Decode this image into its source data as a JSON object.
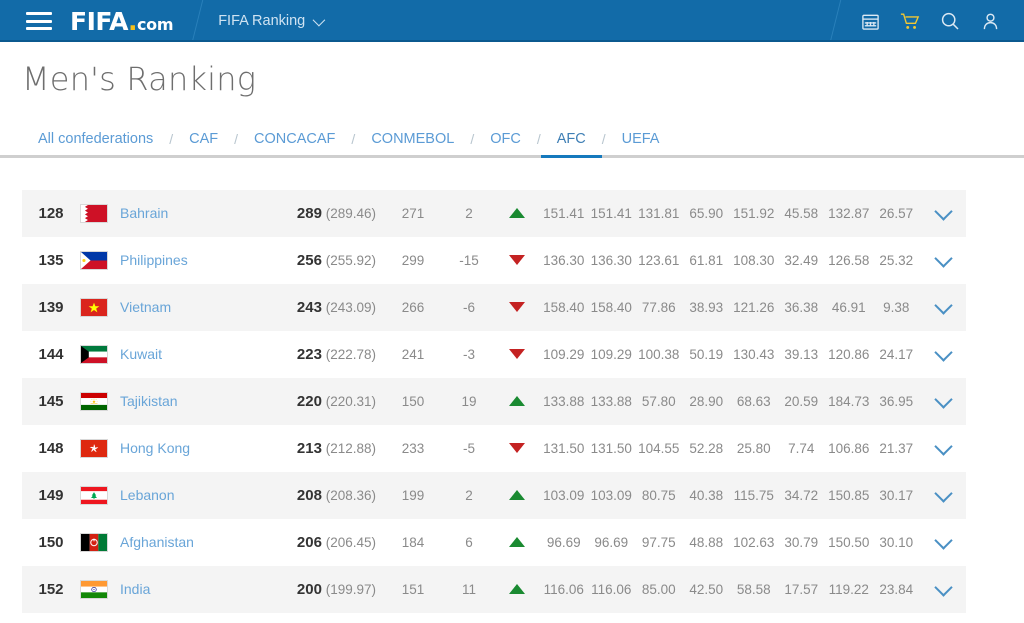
{
  "topbar": {
    "menu_icon": "hamburger-icon",
    "brand": "FIFA",
    "brand_suffix": ".com",
    "section_label": "FIFA Ranking",
    "icons": [
      "calendar-icon",
      "cart-icon",
      "search-icon",
      "user-icon"
    ]
  },
  "header": {
    "title": "Men's Ranking"
  },
  "confederations": {
    "separator": "/",
    "tabs": [
      {
        "label": "All confederations",
        "active": false
      },
      {
        "label": "CAF",
        "active": false
      },
      {
        "label": "CONCACAF",
        "active": false
      },
      {
        "label": "CONMEBOL",
        "active": false
      },
      {
        "label": "OFC",
        "active": false
      },
      {
        "label": "AFC",
        "active": true
      },
      {
        "label": "UEFA",
        "active": false
      }
    ]
  },
  "table": {
    "expand_icon": "chevron-down-icon",
    "rows": [
      {
        "rank": "128",
        "team": "Bahrain",
        "flag": "bahrain",
        "points": "289",
        "points_exact": "(289.46)",
        "previous": "271",
        "delta": "2",
        "trend": "up",
        "values": [
          "151.41",
          "151.41",
          "131.81",
          "65.90",
          "151.92",
          "45.58",
          "132.87",
          "26.57"
        ]
      },
      {
        "rank": "135",
        "team": "Philippines",
        "flag": "philippines",
        "points": "256",
        "points_exact": "(255.92)",
        "previous": "299",
        "delta": "-15",
        "trend": "down",
        "values": [
          "136.30",
          "136.30",
          "123.61",
          "61.81",
          "108.30",
          "32.49",
          "126.58",
          "25.32"
        ]
      },
      {
        "rank": "139",
        "team": "Vietnam",
        "flag": "vietnam",
        "points": "243",
        "points_exact": "(243.09)",
        "previous": "266",
        "delta": "-6",
        "trend": "down",
        "values": [
          "158.40",
          "158.40",
          "77.86",
          "38.93",
          "121.26",
          "36.38",
          "46.91",
          "9.38"
        ]
      },
      {
        "rank": "144",
        "team": "Kuwait",
        "flag": "kuwait",
        "points": "223",
        "points_exact": "(222.78)",
        "previous": "241",
        "delta": "-3",
        "trend": "down",
        "values": [
          "109.29",
          "109.29",
          "100.38",
          "50.19",
          "130.43",
          "39.13",
          "120.86",
          "24.17"
        ]
      },
      {
        "rank": "145",
        "team": "Tajikistan",
        "flag": "tajikistan",
        "points": "220",
        "points_exact": "(220.31)",
        "previous": "150",
        "delta": "19",
        "trend": "up",
        "values": [
          "133.88",
          "133.88",
          "57.80",
          "28.90",
          "68.63",
          "20.59",
          "184.73",
          "36.95"
        ]
      },
      {
        "rank": "148",
        "team": "Hong Kong",
        "flag": "hongkong",
        "points": "213",
        "points_exact": "(212.88)",
        "previous": "233",
        "delta": "-5",
        "trend": "down",
        "values": [
          "131.50",
          "131.50",
          "104.55",
          "52.28",
          "25.80",
          "7.74",
          "106.86",
          "21.37"
        ]
      },
      {
        "rank": "149",
        "team": "Lebanon",
        "flag": "lebanon",
        "points": "208",
        "points_exact": "(208.36)",
        "previous": "199",
        "delta": "2",
        "trend": "up",
        "values": [
          "103.09",
          "103.09",
          "80.75",
          "40.38",
          "115.75",
          "34.72",
          "150.85",
          "30.17"
        ]
      },
      {
        "rank": "150",
        "team": "Afghanistan",
        "flag": "afghanistan",
        "points": "206",
        "points_exact": "(206.45)",
        "previous": "184",
        "delta": "6",
        "trend": "up",
        "values": [
          "96.69",
          "96.69",
          "97.75",
          "48.88",
          "102.63",
          "30.79",
          "150.50",
          "30.10"
        ]
      },
      {
        "rank": "152",
        "team": "India",
        "flag": "india",
        "points": "200",
        "points_exact": "(199.97)",
        "previous": "151",
        "delta": "11",
        "trend": "up",
        "values": [
          "116.06",
          "116.06",
          "85.00",
          "42.50",
          "58.58",
          "17.57",
          "119.22",
          "23.84"
        ]
      }
    ]
  },
  "colors": {
    "header_blue": "#126ba8",
    "link_blue": "#69a5d8",
    "accent_blue": "#1579bd",
    "up_green": "#1a8a31",
    "down_red": "#c42222",
    "logo_amber": "#f6c018"
  }
}
